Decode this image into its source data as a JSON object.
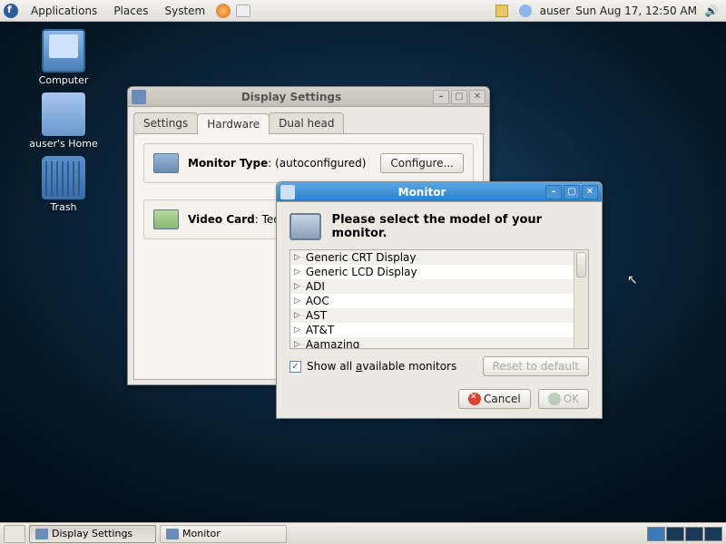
{
  "panel": {
    "menus": [
      "Applications",
      "Places",
      "System"
    ],
    "user": "auser",
    "clock": "Sun Aug 17, 12:50 AM"
  },
  "desktop": {
    "computer": "Computer",
    "home": "auser's Home",
    "trash": "Trash"
  },
  "ds": {
    "title": "Display Settings",
    "tabs": {
      "settings": "Settings",
      "hardware": "Hardware",
      "dualhead": "Dual head"
    },
    "monitor_label": "Monitor Type",
    "monitor_value": "(autoconfigured)",
    "configure": "Configure...",
    "video_label": "Video Card",
    "video_value": "Techn"
  },
  "mon": {
    "title": "Monitor",
    "prompt": "Please select the model of your monitor.",
    "items": [
      "Generic CRT Display",
      "Generic LCD Display",
      "ADI",
      "AOC",
      "AST",
      "AT&T",
      "Aamazing"
    ],
    "show_all": "Show all available monitors",
    "reset": "Reset to default",
    "cancel": "Cancel",
    "ok": "OK"
  },
  "taskbar": {
    "t1": "Display Settings",
    "t2": "Monitor"
  }
}
